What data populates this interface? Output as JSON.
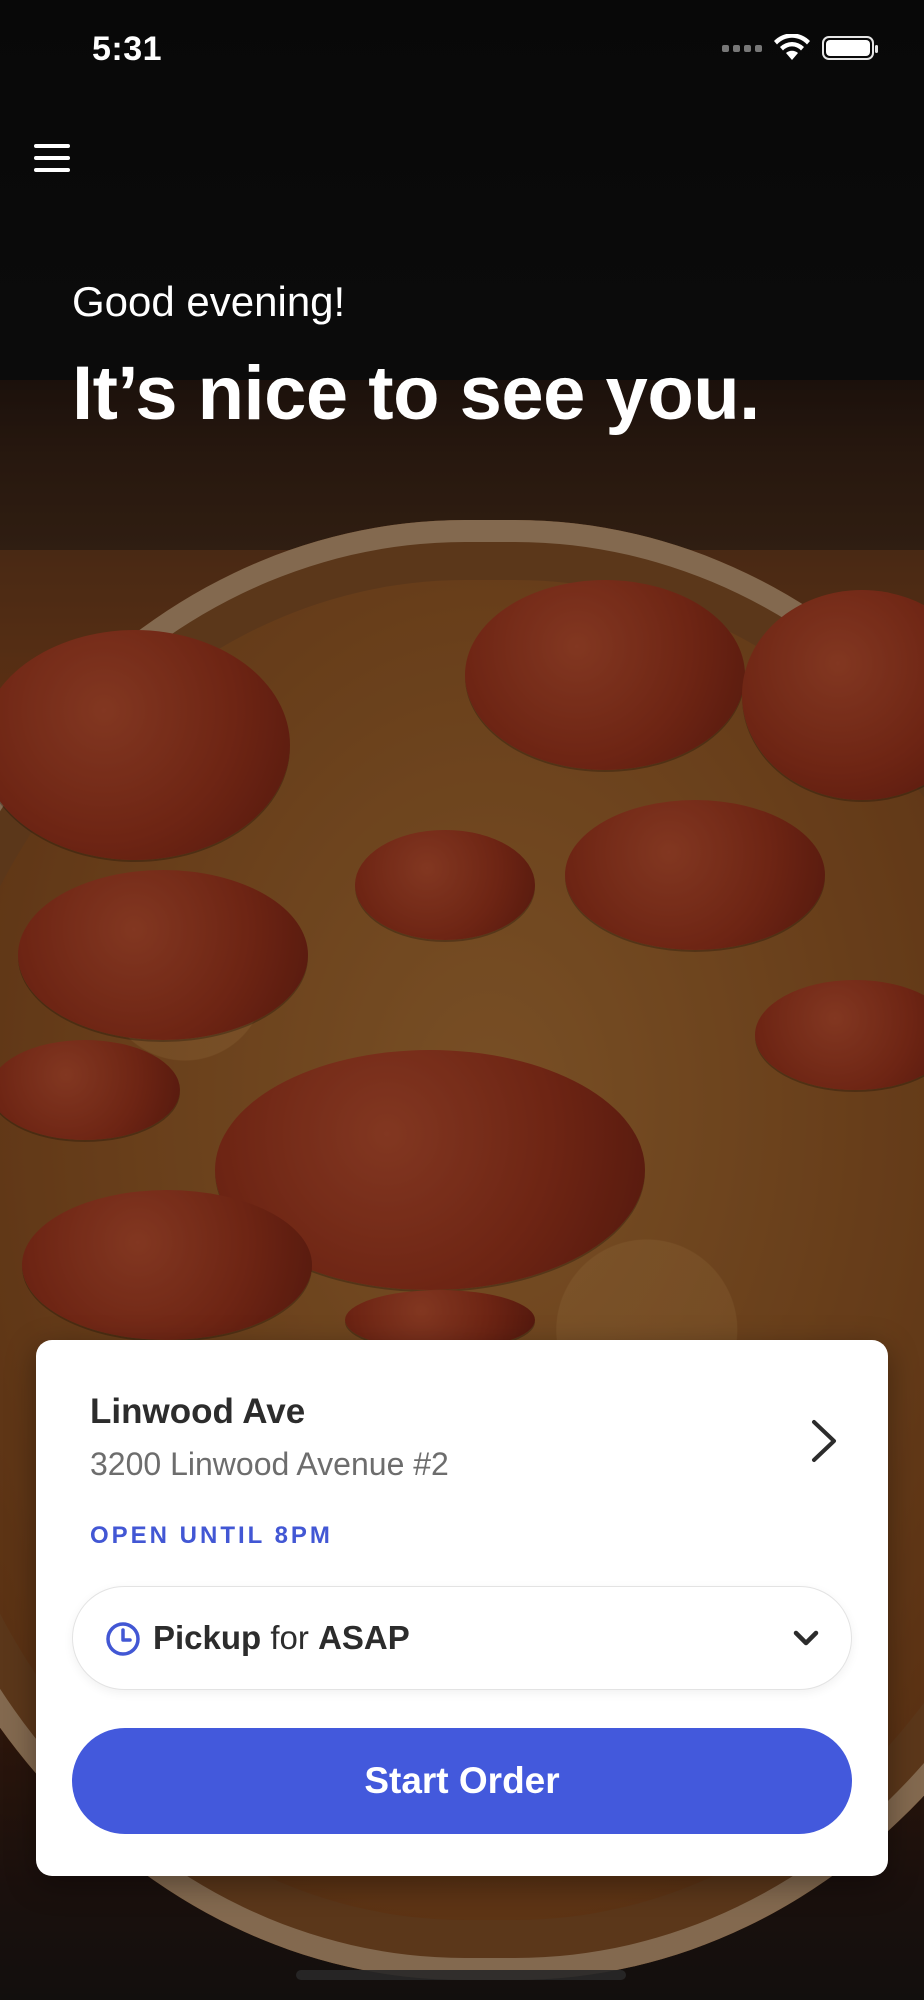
{
  "status_bar": {
    "time": "5:31",
    "icons": [
      "signal-icon",
      "wifi-icon",
      "battery-icon"
    ]
  },
  "header": {
    "menu_icon": "hamburger-menu-icon",
    "greeting": "Good evening!",
    "headline": "It’s nice to see you."
  },
  "location_card": {
    "name": "Linwood Ave",
    "address": "3200 Linwood Avenue #2",
    "open_status": "OPEN UNTIL 8PM",
    "chevron_icon": "chevron-right-icon",
    "pickup": {
      "icon": "clock-icon",
      "mode": "Pickup",
      "connector": "for",
      "time": "ASAP",
      "dropdown_icon": "chevron-down-icon"
    },
    "start_button_label": "Start Order"
  },
  "colors": {
    "accent": "#4359dc",
    "status_text": "#4257d4",
    "card_bg": "#ffffff",
    "heading_text": "#2c2c2c",
    "muted_text": "#6d6d6d"
  }
}
